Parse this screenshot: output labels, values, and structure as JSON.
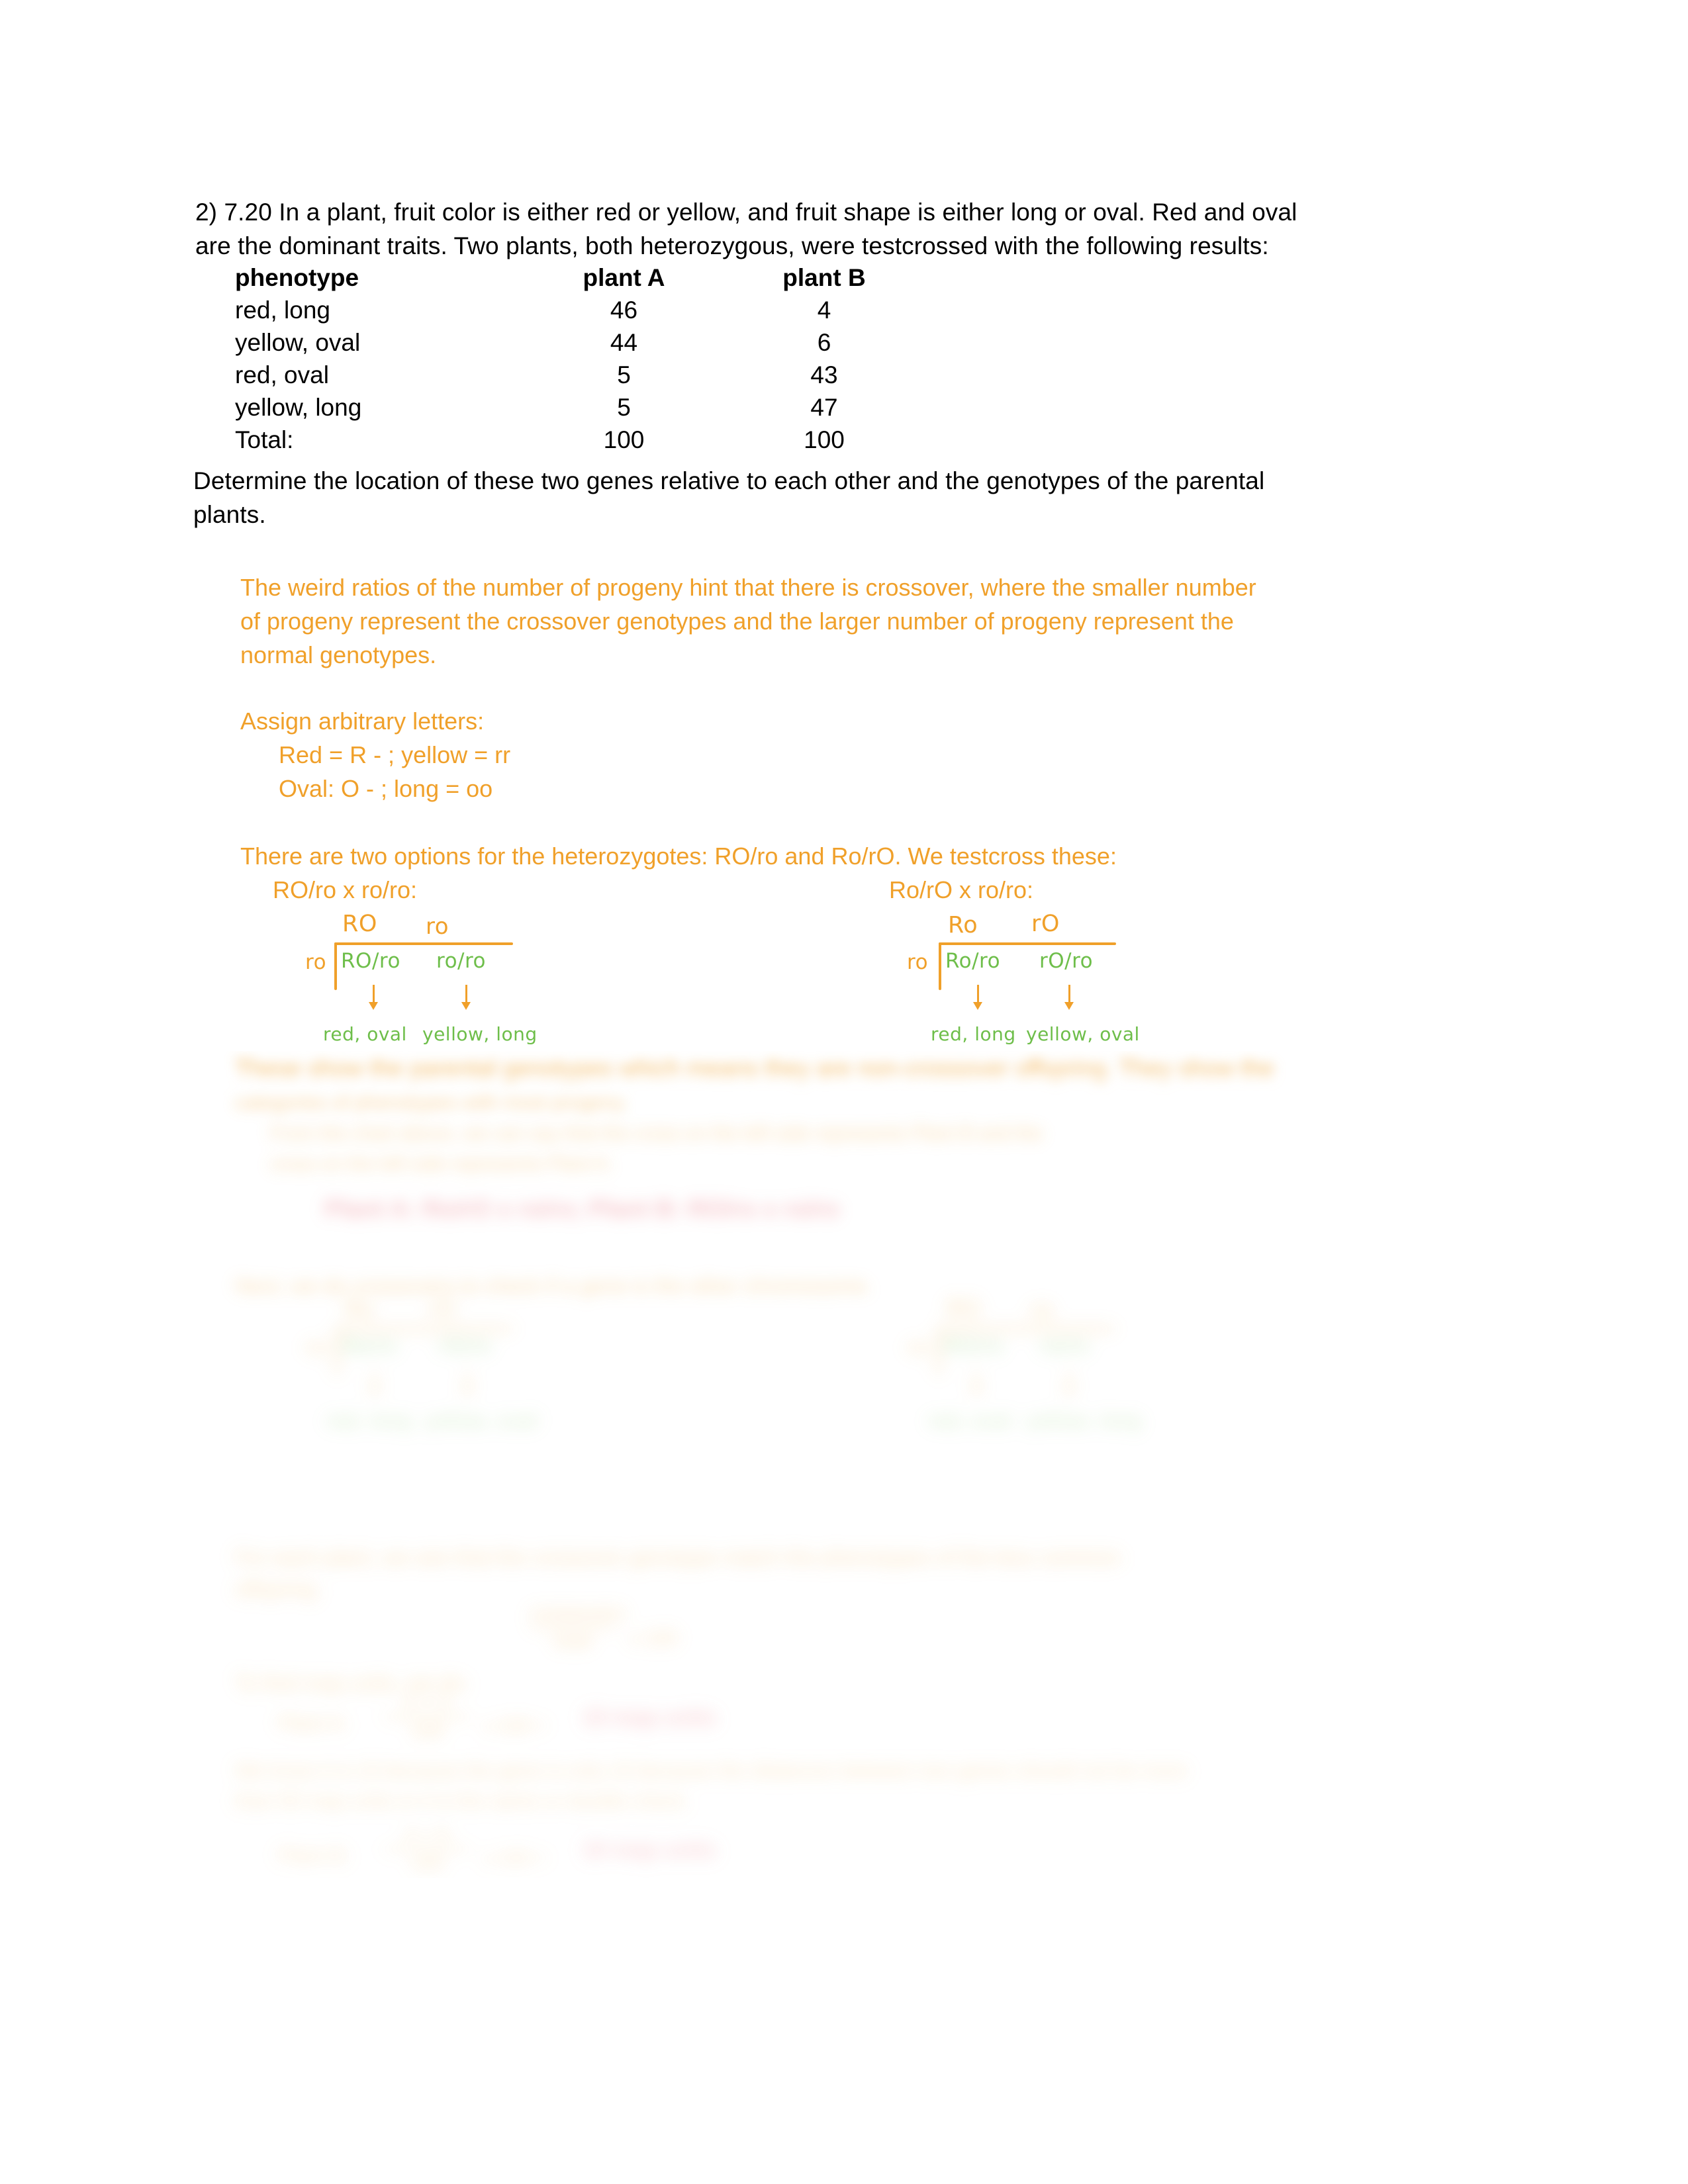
{
  "colors": {
    "ink_black": "#000000",
    "answer_orange": "#F0A02A",
    "hand_green": "#6EBE4A",
    "emphasis_red": "#E8616E"
  },
  "question": {
    "number": "2) 7.20",
    "line1": "2) 7.20 In a plant, fruit color is either red or yellow, and fruit shape is either long or oval. Red and oval",
    "line2": "are the dominant traits. Two plants, both heterozygous, were testcrossed with the following results:",
    "prompt_line1": "Determine the location of these two genes relative to each other and the genotypes of the parental",
    "prompt_line2": "plants."
  },
  "results_table": {
    "headers": [
      "phenotype",
      "plant A",
      "plant B"
    ],
    "rows": [
      [
        "red, long",
        "46",
        "4"
      ],
      [
        "yellow, oval",
        "44",
        "6"
      ],
      [
        "red, oval",
        "5",
        "43"
      ],
      [
        "yellow, long",
        "5",
        "47"
      ],
      [
        "Total:",
        "100",
        "100"
      ]
    ]
  },
  "answer": {
    "para1_line1": "The weird ratios of the number of progeny hint that there is crossover, where the smaller number",
    "para1_line2": "of progeny represent the crossover genotypes and the larger number of progeny represent the",
    "para1_line3": "normal genotypes.",
    "assign_heading": "Assign arbitrary letters:",
    "assign_line1": "Red = R - ; yellow = rr",
    "assign_line2": "Oval: O - ; long = oo",
    "options_heading": "There are two options for the heterozygotes: RO/ro and Ro/rO. We testcross these:",
    "cross_left_label": "RO/ro x ro/ro:",
    "cross_right_label": "Ro/rO x ro/ro:"
  },
  "punnett_left": {
    "top_left": "RO",
    "top_right": "ro",
    "side": "ro",
    "cell_left": "RO/ro",
    "cell_right": "ro/ro",
    "result_left": "red, oval",
    "result_right": "yellow, long"
  },
  "punnett_right": {
    "top_left": "Ro",
    "top_right": "rO",
    "side": "ro",
    "cell_left": "Ro/ro",
    "cell_right": "rO/ro",
    "result_left": "red, long",
    "result_right": "yellow, oval"
  },
  "blurred": {
    "para2_line1": "These show the parental genotypes which means they are non-crossover offspring. They show the",
    "para2_line2": "categories of phenotypes with most progeny.",
    "para2_line3": "From the chart above, we can say that the cross on the left side represents Plant B and the",
    "para2_line4": "cross on the left side represents Plant A.",
    "conclusion": "Plant A: Ro/rO x ro/ro; Plant B: RO/ro x ro/ro",
    "para3": "Next, we do crossovers to check if a gene is the other chromosome.",
    "cross2_left_label": "RO/ro x ro/ro:",
    "cross2_right_label": "Ro/rO x ro/ro:",
    "punnett2_left": {
      "top_left": "Ro",
      "top_right": "rO",
      "side": "ro",
      "cell_left": "Ro/ro",
      "cell_right": "rO/ro",
      "result_left": "red, long",
      "result_right": "yellow, oval"
    },
    "punnett2_right": {
      "top_left": "RO",
      "top_right": "ro",
      "side": "ro",
      "cell_left": "RO/ro",
      "cell_right": "ro/ro",
      "result_left": "red, oval",
      "result_right": "yellow, long"
    },
    "para4_line1": "For each plant, we see that the crossover genotype match the phenotypes of the less common",
    "para4_line2": "offspring.",
    "para5": "To find map units, we do:",
    "formula_note_num": "crossovers",
    "formula_note_den": "total",
    "formula_note_eq": "x 100",
    "plantA_label": "Plant A:",
    "plantA_num": "5 + 5",
    "plantA_den": "100",
    "plantA_mid": "x 100 =",
    "plantA_result": "10 map units",
    "para6_line1": "We know it is 10 because the gene is only 10 because the distances between two genes should not be more",
    "para6_line2": "than 50 map units or it is the same or double check.",
    "plantB_label": "Plant B:",
    "plantB_num": "4 + 6",
    "plantB_den": "100",
    "plantB_mid": "x 100 =",
    "plantB_result": "10 map units"
  }
}
